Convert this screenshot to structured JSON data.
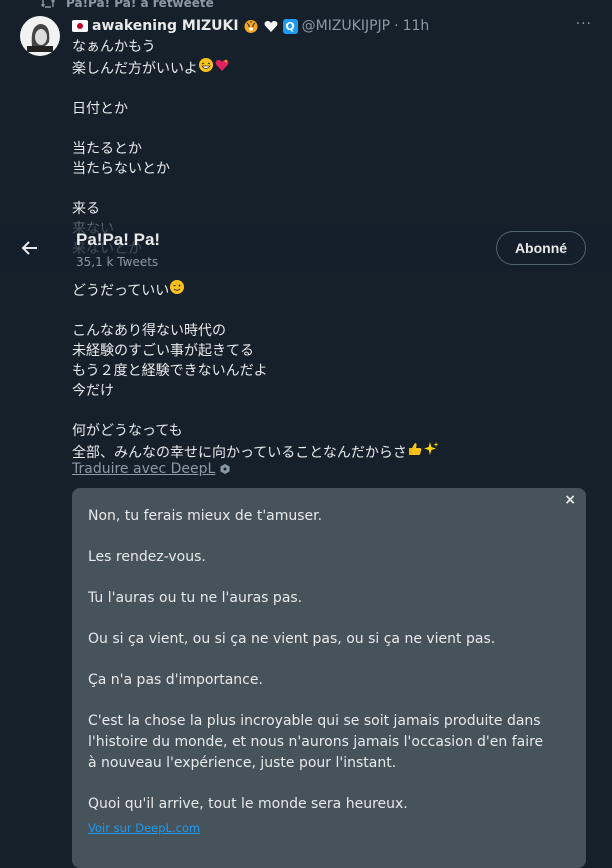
{
  "retweet": {
    "text": "Pa!Pa! Pa! a retweeté"
  },
  "tweet": {
    "display_name": "awakening MIZUKI",
    "badge_letter": "Q",
    "handle": "@MIZUKIJPJP",
    "separator": "·",
    "time": "11h",
    "more": "···",
    "avatar_label": "MIZUKI",
    "lines_top": [
      "なぁんかもう",
      "楽しんだ方がいいよ",
      "日付とか",
      "当たるとか",
      "当たらないとか",
      "来る"
    ],
    "lines_hidden": [
      "来ない",
      "来ないとか"
    ],
    "lines_bottom": [
      "どうだっていい",
      "こんなあり得ない時代の",
      "未経験のすごい事が起きてる",
      "もう２度と経験できないんだよ",
      "今だけ",
      "何がどうなっても",
      "全部、みんなの幸せに向かっていることなんだからさ"
    ]
  },
  "overlay_header": {
    "title": "Pa!Pa! Pa!",
    "subtitle": "35,1 k Tweets",
    "follow_label": "Abonné"
  },
  "translate_link": "Traduire avec DeepL",
  "translation": {
    "close": "×",
    "paragraphs": [
      "Non, tu ferais mieux de t'amuser.",
      "Les rendez-vous.",
      "Tu l'auras ou tu ne l'auras pas.",
      "Ou si ça vient, ou si ça ne vient pas, ou si ça ne vient pas.",
      "Ça n'a pas d'importance.",
      "C'est la chose la plus incroyable qui se soit jamais produite dans l'histoire du monde, et nous n'aurons jamais l'occasion d'en faire à nouveau l'expérience, juste pour l'instant.",
      "Quoi qu'il arrive, tout le monde sera heureux."
    ],
    "source_link": "Voir sur DeepL.com"
  },
  "colors": {
    "background": "#15202b",
    "accent": "#1d9bf0",
    "muted": "#8b98a5",
    "box": "#47535b"
  },
  "icons": [
    "retweet-icon",
    "flag-icon",
    "tiger-icon",
    "white-heart-icon",
    "q-badge-icon",
    "more-icon",
    "back-arrow-icon",
    "deepl-icon",
    "close-icon",
    "grin-emoji",
    "sparkling-heart-emoji",
    "wink-emoji",
    "thumbs-up-emoji",
    "sparkles-emoji"
  ]
}
